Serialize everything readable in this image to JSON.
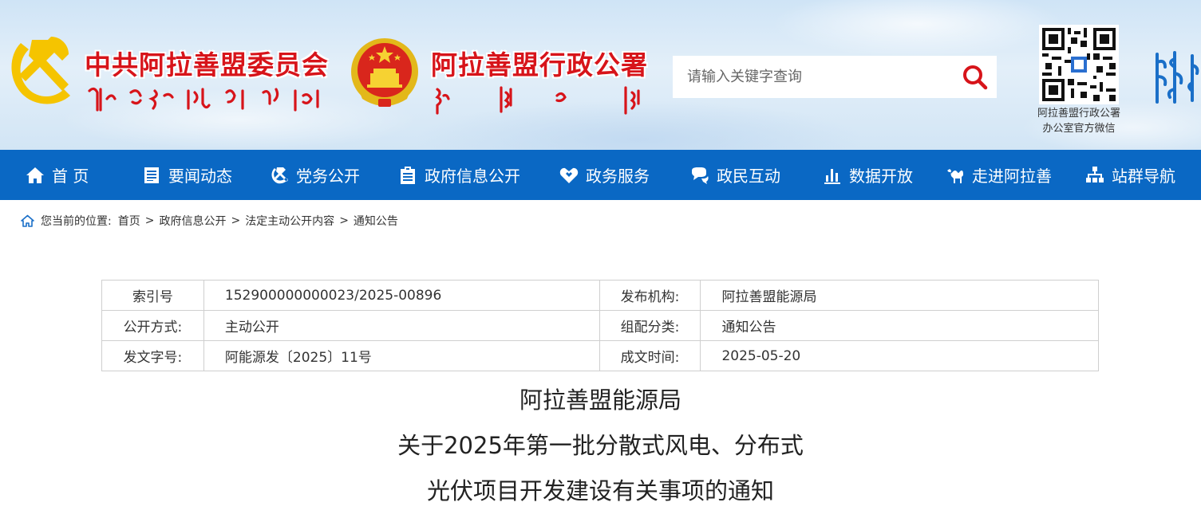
{
  "header": {
    "party_title": "中共阿拉善盟委员会",
    "gov_title": "阿拉善盟行政公署",
    "search": {
      "placeholder": "请输入关键字查询"
    },
    "qr_caption_line1": "阿拉善盟行政公署",
    "qr_caption_line2": "办公室官方微信",
    "icons": {
      "search": "search-icon",
      "party": "party-emblem",
      "gov": "national-emblem",
      "qr": "qr-code"
    },
    "colors": {
      "title_red": "#d7141a",
      "nav_blue": "#0a68c4"
    }
  },
  "nav": {
    "items": [
      {
        "label": "首 页",
        "icon": "home-icon"
      },
      {
        "label": "要闻动态",
        "icon": "news-icon"
      },
      {
        "label": "党务公开",
        "icon": "party-icon"
      },
      {
        "label": "政府信息公开",
        "icon": "gov-info-icon"
      },
      {
        "label": "政务服务",
        "icon": "service-icon"
      },
      {
        "label": "政民互动",
        "icon": "chat-icon"
      },
      {
        "label": "数据开放",
        "icon": "chart-icon"
      },
      {
        "label": "走进阿拉善",
        "icon": "camel-icon"
      },
      {
        "label": "站群导航",
        "icon": "sitemap-icon"
      }
    ]
  },
  "breadcrumb": {
    "prefix": "您当前的位置:",
    "items": [
      "首页",
      "政府信息公开",
      "法定主动公开内容",
      "通知公告"
    ],
    "separator": ">"
  },
  "meta": {
    "rows": [
      {
        "label1": "索引号",
        "value1": "152900000000023/2025-00896",
        "label2": "发布机构:",
        "value2": "阿拉善盟能源局"
      },
      {
        "label1": "公开方式:",
        "value1": "主动公开",
        "label2": "组配分类:",
        "value2": "通知公告"
      },
      {
        "label1": "发文字号:",
        "value1": "阿能源发〔2025〕11号",
        "label2": "成文时间:",
        "value2": "2025-05-20"
      }
    ]
  },
  "article": {
    "title_lines": [
      "阿拉善盟能源局",
      "关于2025年第一批分散式风电、分布式",
      "光伏项目开发建设有关事项的通知"
    ]
  }
}
